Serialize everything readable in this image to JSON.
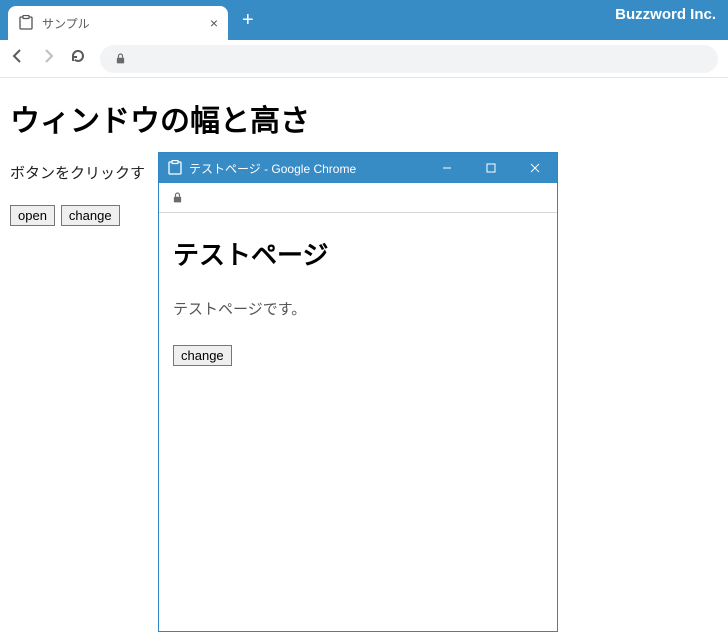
{
  "brand": "Buzzword Inc.",
  "tab": {
    "title": "サンプル"
  },
  "page": {
    "heading": "ウィンドウの幅と高さ",
    "text": "ボタンをクリックす",
    "open_label": "open",
    "change_label": "change"
  },
  "popup": {
    "title": "テストページ - Google Chrome",
    "heading": "テストページ",
    "text": "テストページです。",
    "change_label": "change"
  }
}
